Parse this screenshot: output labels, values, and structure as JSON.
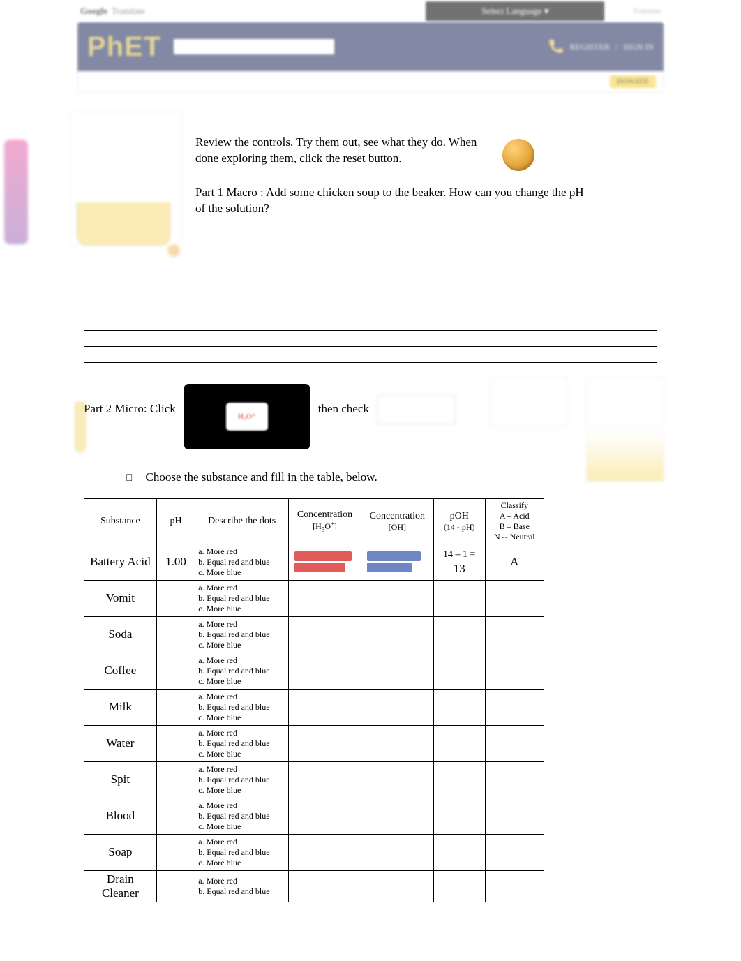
{
  "phet": {
    "google": "Google",
    "translate": "Translate",
    "select_language": "Select Language ▾",
    "translate_tag": "Translate",
    "logo": "PhET",
    "register": "REGISTER",
    "signin": "SIGN IN",
    "donate": "DONATE"
  },
  "intro": {
    "review": "Review the controls. Try them out, see what they do. When done exploring them, click the reset button.",
    "part1": "Part 1 Macro : Add some chicken soup to the beaker. How can you change the pH of the solution?"
  },
  "part2": {
    "lead": "Part 2 Micro: Click",
    "then_check": "then check",
    "bullet": "Choose the substance and fill in the table, below."
  },
  "micro_inner": "H₃O⁺",
  "table": {
    "headers": {
      "substance": "Substance",
      "ph": "pH",
      "dots": "Describe the dots",
      "h3o": "Concentration",
      "h3o_sub": "[H₃O⁺]",
      "oh": "Concentration",
      "oh_sub": "[OH]",
      "poh": "pOH",
      "poh_sub": "(14 - pH)",
      "classify": "Classify",
      "classify_lines": [
        "A – Acid",
        "B – Base",
        "N -- Neutral"
      ]
    },
    "dots_options": [
      "a. More red",
      "b. Equal red and blue",
      "c. More blue"
    ],
    "rows": [
      {
        "substance": "Battery Acid",
        "ph": "1.00",
        "h3o": "bars-red",
        "oh": "bars-blue",
        "poh_expr": "14 – 1 =",
        "poh_val": "13",
        "classify": "A"
      },
      {
        "substance": "Vomit",
        "ph": "",
        "h3o": "",
        "oh": "",
        "poh_expr": "",
        "poh_val": "",
        "classify": ""
      },
      {
        "substance": "Soda",
        "ph": "",
        "h3o": "",
        "oh": "",
        "poh_expr": "",
        "poh_val": "",
        "classify": ""
      },
      {
        "substance": "Coffee",
        "ph": "",
        "h3o": "",
        "oh": "",
        "poh_expr": "",
        "poh_val": "",
        "classify": ""
      },
      {
        "substance": "Milk",
        "ph": "",
        "h3o": "",
        "oh": "",
        "poh_expr": "",
        "poh_val": "",
        "classify": ""
      },
      {
        "substance": "Water",
        "ph": "",
        "h3o": "",
        "oh": "",
        "poh_expr": "",
        "poh_val": "",
        "classify": ""
      },
      {
        "substance": "Spit",
        "ph": "",
        "h3o": "",
        "oh": "",
        "poh_expr": "",
        "poh_val": "",
        "classify": ""
      },
      {
        "substance": "Blood",
        "ph": "",
        "h3o": "",
        "oh": "",
        "poh_expr": "",
        "poh_val": "",
        "classify": ""
      },
      {
        "substance": "Soap",
        "ph": "",
        "h3o": "",
        "oh": "",
        "poh_expr": "",
        "poh_val": "",
        "classify": ""
      },
      {
        "substance": "Drain Cleaner",
        "ph": "",
        "h3o": "",
        "oh": "",
        "poh_expr": "",
        "poh_val": "",
        "classify": "",
        "truncated": true
      }
    ]
  }
}
